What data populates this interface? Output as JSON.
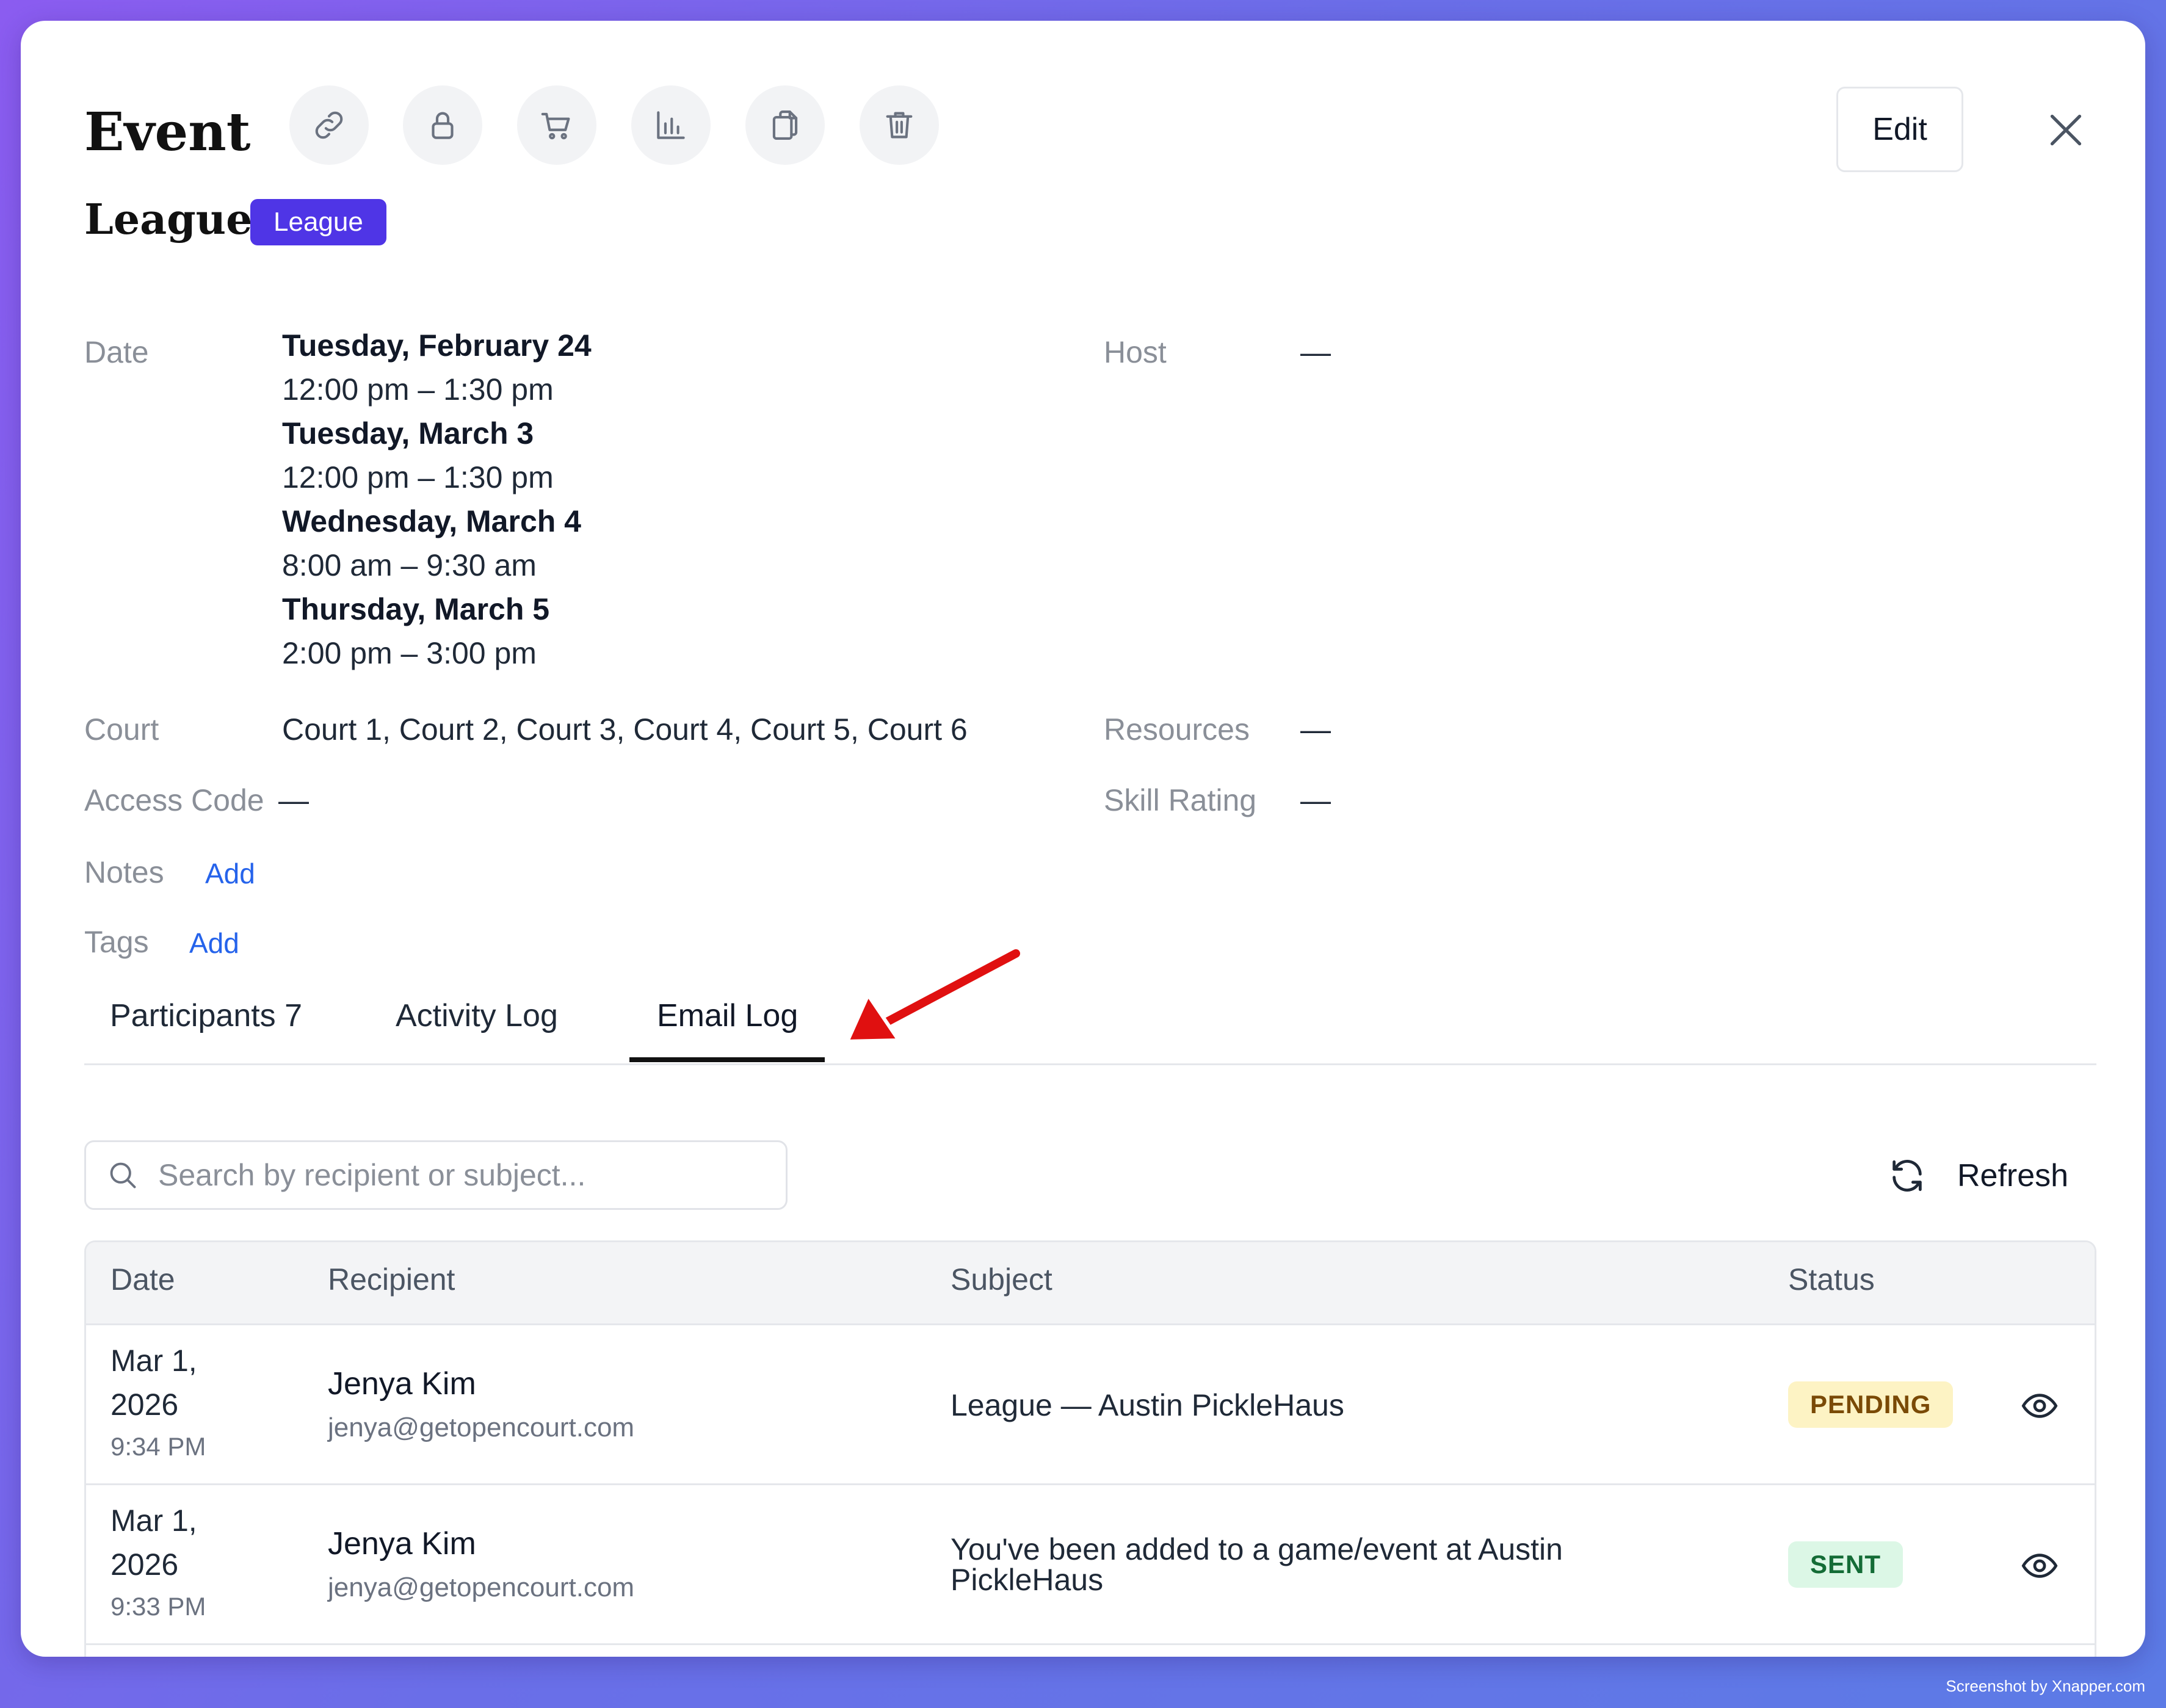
{
  "header": {
    "title": "Event",
    "edit_label": "Edit",
    "toolbar_icons": [
      "link-icon",
      "lock-icon",
      "cart-icon",
      "bar-chart-icon",
      "copy-icon",
      "trash-icon"
    ]
  },
  "event": {
    "name": "League",
    "type_badge": "League",
    "details": {
      "date_label": "Date",
      "schedule": [
        {
          "day": "Tuesday, February 24",
          "time": "12:00 pm – 1:30 pm"
        },
        {
          "day": "Tuesday, March 3",
          "time": "12:00 pm – 1:30 pm"
        },
        {
          "day": "Wednesday, March 4",
          "time": "8:00 am – 9:30 am"
        },
        {
          "day": "Thursday, March 5",
          "time": "2:00 pm – 3:00 pm"
        }
      ],
      "host_label": "Host",
      "host_value": "—",
      "court_label": "Court",
      "court_value": "Court 1, Court 2, Court 3, Court 4, Court 5, Court 6",
      "resources_label": "Resources",
      "resources_value": "—",
      "access_code_label": "Access Code",
      "access_code_value": "—",
      "skill_rating_label": "Skill Rating",
      "skill_rating_value": "—",
      "notes_label": "Notes",
      "notes_add": "Add",
      "tags_label": "Tags",
      "tags_add": "Add"
    }
  },
  "tabs": [
    {
      "label": "Participants 7",
      "active": false
    },
    {
      "label": "Activity Log",
      "active": false
    },
    {
      "label": "Email Log",
      "active": true
    }
  ],
  "email_log": {
    "search_placeholder": "Search by recipient or subject...",
    "refresh_label": "Refresh",
    "columns": [
      "Date",
      "Recipient",
      "Subject",
      "Status"
    ],
    "rows": [
      {
        "date_line1": "Mar 1,",
        "date_line2": "2026",
        "time": "9:34 PM",
        "recipient_name": "Jenya Kim",
        "recipient_email": "jenya@getopencourt.com",
        "subject": "League — Austin PickleHaus",
        "status": "PENDING"
      },
      {
        "date_line1": "Mar 1,",
        "date_line2": "2026",
        "time": "9:33 PM",
        "recipient_name": "Jenya Kim",
        "recipient_email": "jenya@getopencourt.com",
        "subject": "You've been added to a game/event at Austin PickleHaus",
        "status": "SENT"
      }
    ]
  },
  "colors": {
    "badge_bg": "#4f35e6",
    "link": "#2563eb",
    "pending_bg": "#fdf3c4",
    "pending_text": "#7a4a06",
    "sent_bg": "#dcf7e6",
    "sent_text": "#146c36",
    "annotation_arrow": "#e01010"
  },
  "watermark": "Screenshot by Xnapper.com"
}
